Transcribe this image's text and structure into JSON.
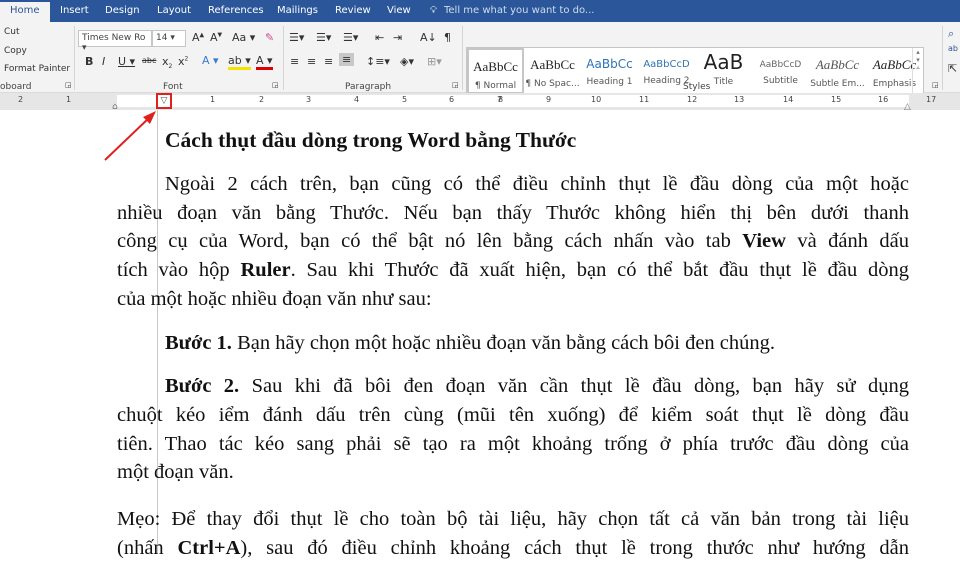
{
  "tabs": [
    "Home",
    "Insert",
    "Design",
    "Layout",
    "References",
    "Mailings",
    "Review",
    "View"
  ],
  "tell_me": "Tell me what you want to do...",
  "clipboard": {
    "cut": "Cut",
    "copy": "Copy",
    "format_painter": "Format Painter",
    "label": "oboard"
  },
  "font": {
    "name": "Times New Ro",
    "size": "14",
    "label": "Font"
  },
  "paragraph": {
    "label": "Paragraph"
  },
  "styles": {
    "label": "Styles",
    "items": [
      {
        "preview": "AaBbCc",
        "name": "¶ Normal"
      },
      {
        "preview": "AaBbCc",
        "name": "¶ No Spac..."
      },
      {
        "preview": "AaBbCc",
        "name": "Heading 1"
      },
      {
        "preview": "AaBbCcD",
        "name": "Heading 2"
      },
      {
        "preview": "AaB",
        "name": "Title"
      },
      {
        "preview": "AaBbCcD",
        "name": "Subtitle"
      },
      {
        "preview": "AaBbCc",
        "name": "Subtle Em..."
      },
      {
        "preview": "AaBbCc",
        "name": "Emphasis"
      }
    ]
  },
  "ruler": [
    "2",
    "1",
    "1",
    "2",
    "3",
    "4",
    "5",
    "6",
    "7",
    "8",
    "9",
    "10",
    "11",
    "12",
    "13",
    "14",
    "15",
    "16",
    "17"
  ],
  "accent": "#2b579a",
  "doc": {
    "heading": "Cách thụt đầu dòng trong Word bằng Thước",
    "p1": [
      "Ngoài 2 cách trên, bạn cũng có thể điều chỉnh thụt lề đầu dòng của một hoặc",
      "nhiều đoạn văn bằng Thước. Nếu bạn thấy Thước không hiển thị bên dưới thanh",
      "công cụ của Word, bạn có thể bật nó lên bằng cách nhấn vào tab ",
      "View",
      " và đánh dấu",
      "tích vào hộp ",
      "Ruler",
      ". Sau khi Thước đã xuất hiện, bạn có thể bắt đầu thụt lề đầu dòng",
      "của một hoặc nhiều đoạn văn như sau:"
    ],
    "s1": [
      "Bước 1.",
      " Bạn hãy chọn một hoặc nhiều đoạn văn bằng cách bôi đen chúng."
    ],
    "s2": [
      "Bước 2.",
      " Sau khi đã bôi đen đoạn văn cần thụt lề đầu dòng, bạn hãy sử dụng",
      "chuột kéo iểm đánh dấu trên cùng (mũi tên xuống) để kiểm soát thụt lề dòng đầu",
      "tiên. Thao tác kéo sang phải sẽ tạo ra một khoảng trống ở phía trước đầu dòng của",
      "một đoạn văn."
    ],
    "tip": [
      "Mẹo: Để thay đổi thụt lề cho toàn bộ tài liệu, hãy chọn tất cả văn bản trong tài liệu",
      "(nhấn ",
      "Ctrl+A",
      "), sau đó điều chỉnh khoảng cách thụt lề trong thước như hướng dẫn"
    ]
  }
}
